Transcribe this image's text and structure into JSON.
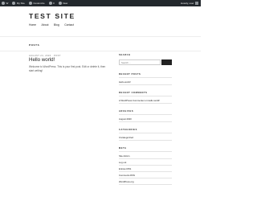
{
  "adminbar": {
    "items": [
      "W",
      "My Site",
      "Customize",
      "0",
      "New"
    ],
    "right": "Howdy, user"
  },
  "header": {
    "site_title": "TEST SITE",
    "nav": [
      "Home",
      "About",
      "Blog",
      "Contact"
    ]
  },
  "main": {
    "heading": "POSTS",
    "post": {
      "meta": "AUGUST 24, 2020 · POST",
      "title": "Hello world!",
      "excerpt": "Welcome to WordPress. This is your first post. Edit or delete it, then start writing!"
    }
  },
  "sidebar": {
    "search": {
      "title": "SEARCH",
      "placeholder": "Search ..."
    },
    "recent_posts": {
      "title": "RECENT POSTS",
      "items": [
        "Hello world!"
      ]
    },
    "recent_comments": {
      "title": "RECENT COMMENTS",
      "items": [
        "A WordPress Commenter on Hello world!"
      ]
    },
    "archives": {
      "title": "ARCHIVES",
      "items": [
        "August 2020"
      ]
    },
    "categories": {
      "title": "CATEGORIES",
      "items": [
        "Uncategorized"
      ]
    },
    "meta": {
      "title": "META",
      "items": [
        "Site Admin",
        "Log out",
        "Entries RSS",
        "Comments RSS",
        "WordPress.org"
      ]
    }
  }
}
